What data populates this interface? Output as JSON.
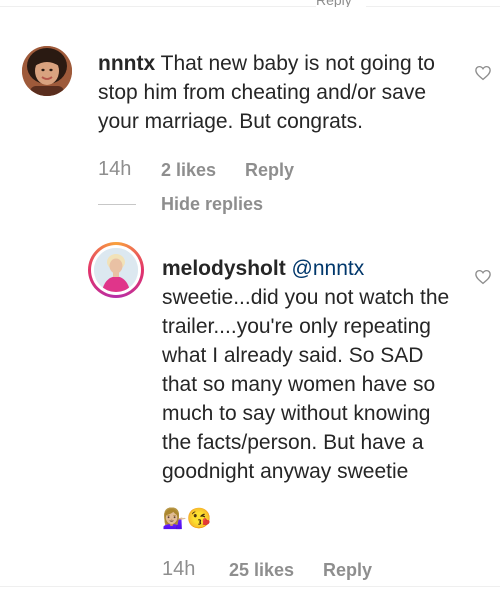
{
  "top_stub": "Reply",
  "comments": [
    {
      "username": "nnntx",
      "text": "That new baby is not going to stop him from cheating and/or save your marriage. But congrats.",
      "time": "14h",
      "likes": "2 likes",
      "reply_label": "Reply",
      "avatar_icon": "profile-photo"
    }
  ],
  "hide_replies": "Hide replies",
  "replies": [
    {
      "username": "melodysholt",
      "mention": "@nnntx",
      "text": "sweetie...did you not watch the trailer....you're only repeating what I already said. So SAD that so many women have so much to say without knowing the facts/person. But have a goodnight anyway sweetie",
      "emojis": "💁🏼‍♀️😘",
      "time": "14h",
      "likes": "25 likes",
      "reply_label": "Reply",
      "avatar_icon": "profile-photo-with-story-ring"
    }
  ],
  "icons": {
    "like": "heart-outline-icon"
  },
  "colors": {
    "text": "#262626",
    "muted": "#8e8e8e",
    "mention": "#00376b"
  }
}
